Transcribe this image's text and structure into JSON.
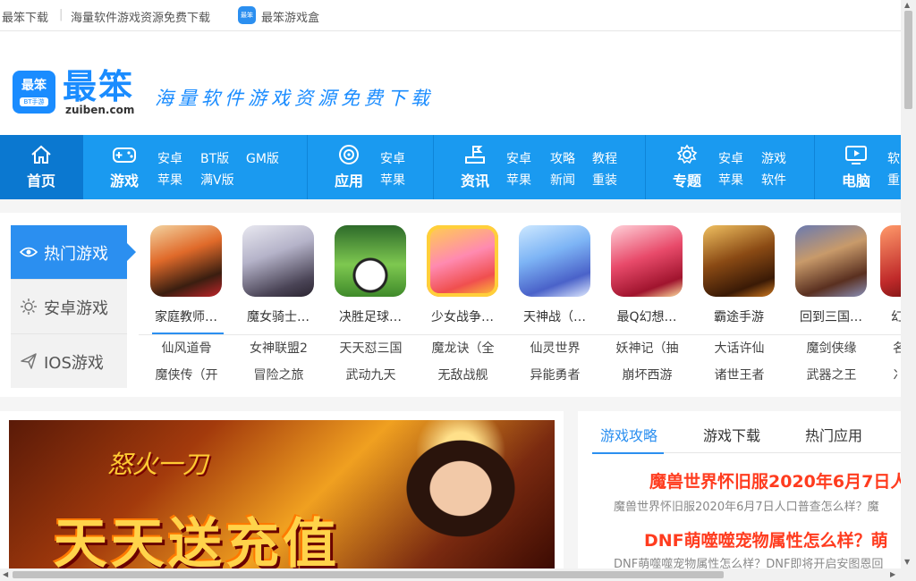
{
  "topbar": {
    "items": [
      "最笨下载",
      "海量软件游戏资源免费下载",
      "最笨游戏盒"
    ],
    "icon_label": "最笨"
  },
  "header": {
    "logo_badge": "最笨",
    "logo_badge_sub": "BT手游",
    "logo_text": "最笨",
    "logo_url": "zuiben.com",
    "slogan": "海量软件游戏资源免费下载"
  },
  "nav": {
    "home": "首页",
    "groups": [
      {
        "title": "游戏",
        "icon": "gamepad-icon",
        "subs": [
          "安卓",
          "BT版",
          "GM版",
          "苹果",
          "满V版"
        ]
      },
      {
        "title": "应用",
        "icon": "app-target-icon",
        "subs": [
          "安卓",
          "苹果"
        ]
      },
      {
        "title": "资讯",
        "icon": "news-flag-icon",
        "subs": [
          "安卓",
          "攻略",
          "教程",
          "苹果",
          "新闻",
          "重装"
        ]
      },
      {
        "title": "专题",
        "icon": "gear-icon",
        "subs": [
          "安卓",
          "游戏",
          "苹果",
          "软件"
        ]
      },
      {
        "title": "电脑",
        "icon": "monitor-icon",
        "subs": [
          "软",
          "重"
        ]
      }
    ]
  },
  "hot": {
    "tabs": [
      "热门游戏",
      "安卓游戏",
      "IOS游戏"
    ],
    "games": [
      "家庭教师…",
      "魔女骑士…",
      "决胜足球…",
      "少女战争…",
      "天神战（…",
      "最Q幻想…",
      "霸途手游",
      "回到三国…",
      "幻"
    ],
    "list_row1": [
      "仙风道骨",
      "女神联盟2",
      "天天怼三国",
      "魔龙诀（全",
      "仙灵世界",
      "妖神记（抽",
      "大话许仙",
      "魔剑侠缘",
      "名"
    ],
    "list_row2": [
      "魔侠传（开",
      "冒险之旅",
      "武动九天",
      "无敌战舰",
      "异能勇者",
      "崩坏西游",
      "诸世王者",
      "武器之王",
      "冫"
    ]
  },
  "banner": {
    "sub": "怒火一刀",
    "title": "天天送充值"
  },
  "news": {
    "tabs": [
      "游戏攻略",
      "游戏下载",
      "热门应用"
    ],
    "items": [
      {
        "headline": "魔兽世界怀旧服2020年6月7日人",
        "desc": "魔兽世界怀旧服2020年6月7日人口普查怎么样？魔"
      },
      {
        "headline": "DNF萌噬噬宠物属性怎么样？萌",
        "desc": "DNF萌噬噬宠物属性怎么样？DNF即将开启安图恩回"
      }
    ]
  },
  "colors": {
    "accent": "#2b8ff0",
    "nav_bg": "#1a9af0",
    "home_bg": "#0b78d0",
    "headline": "#ff3c1f"
  }
}
